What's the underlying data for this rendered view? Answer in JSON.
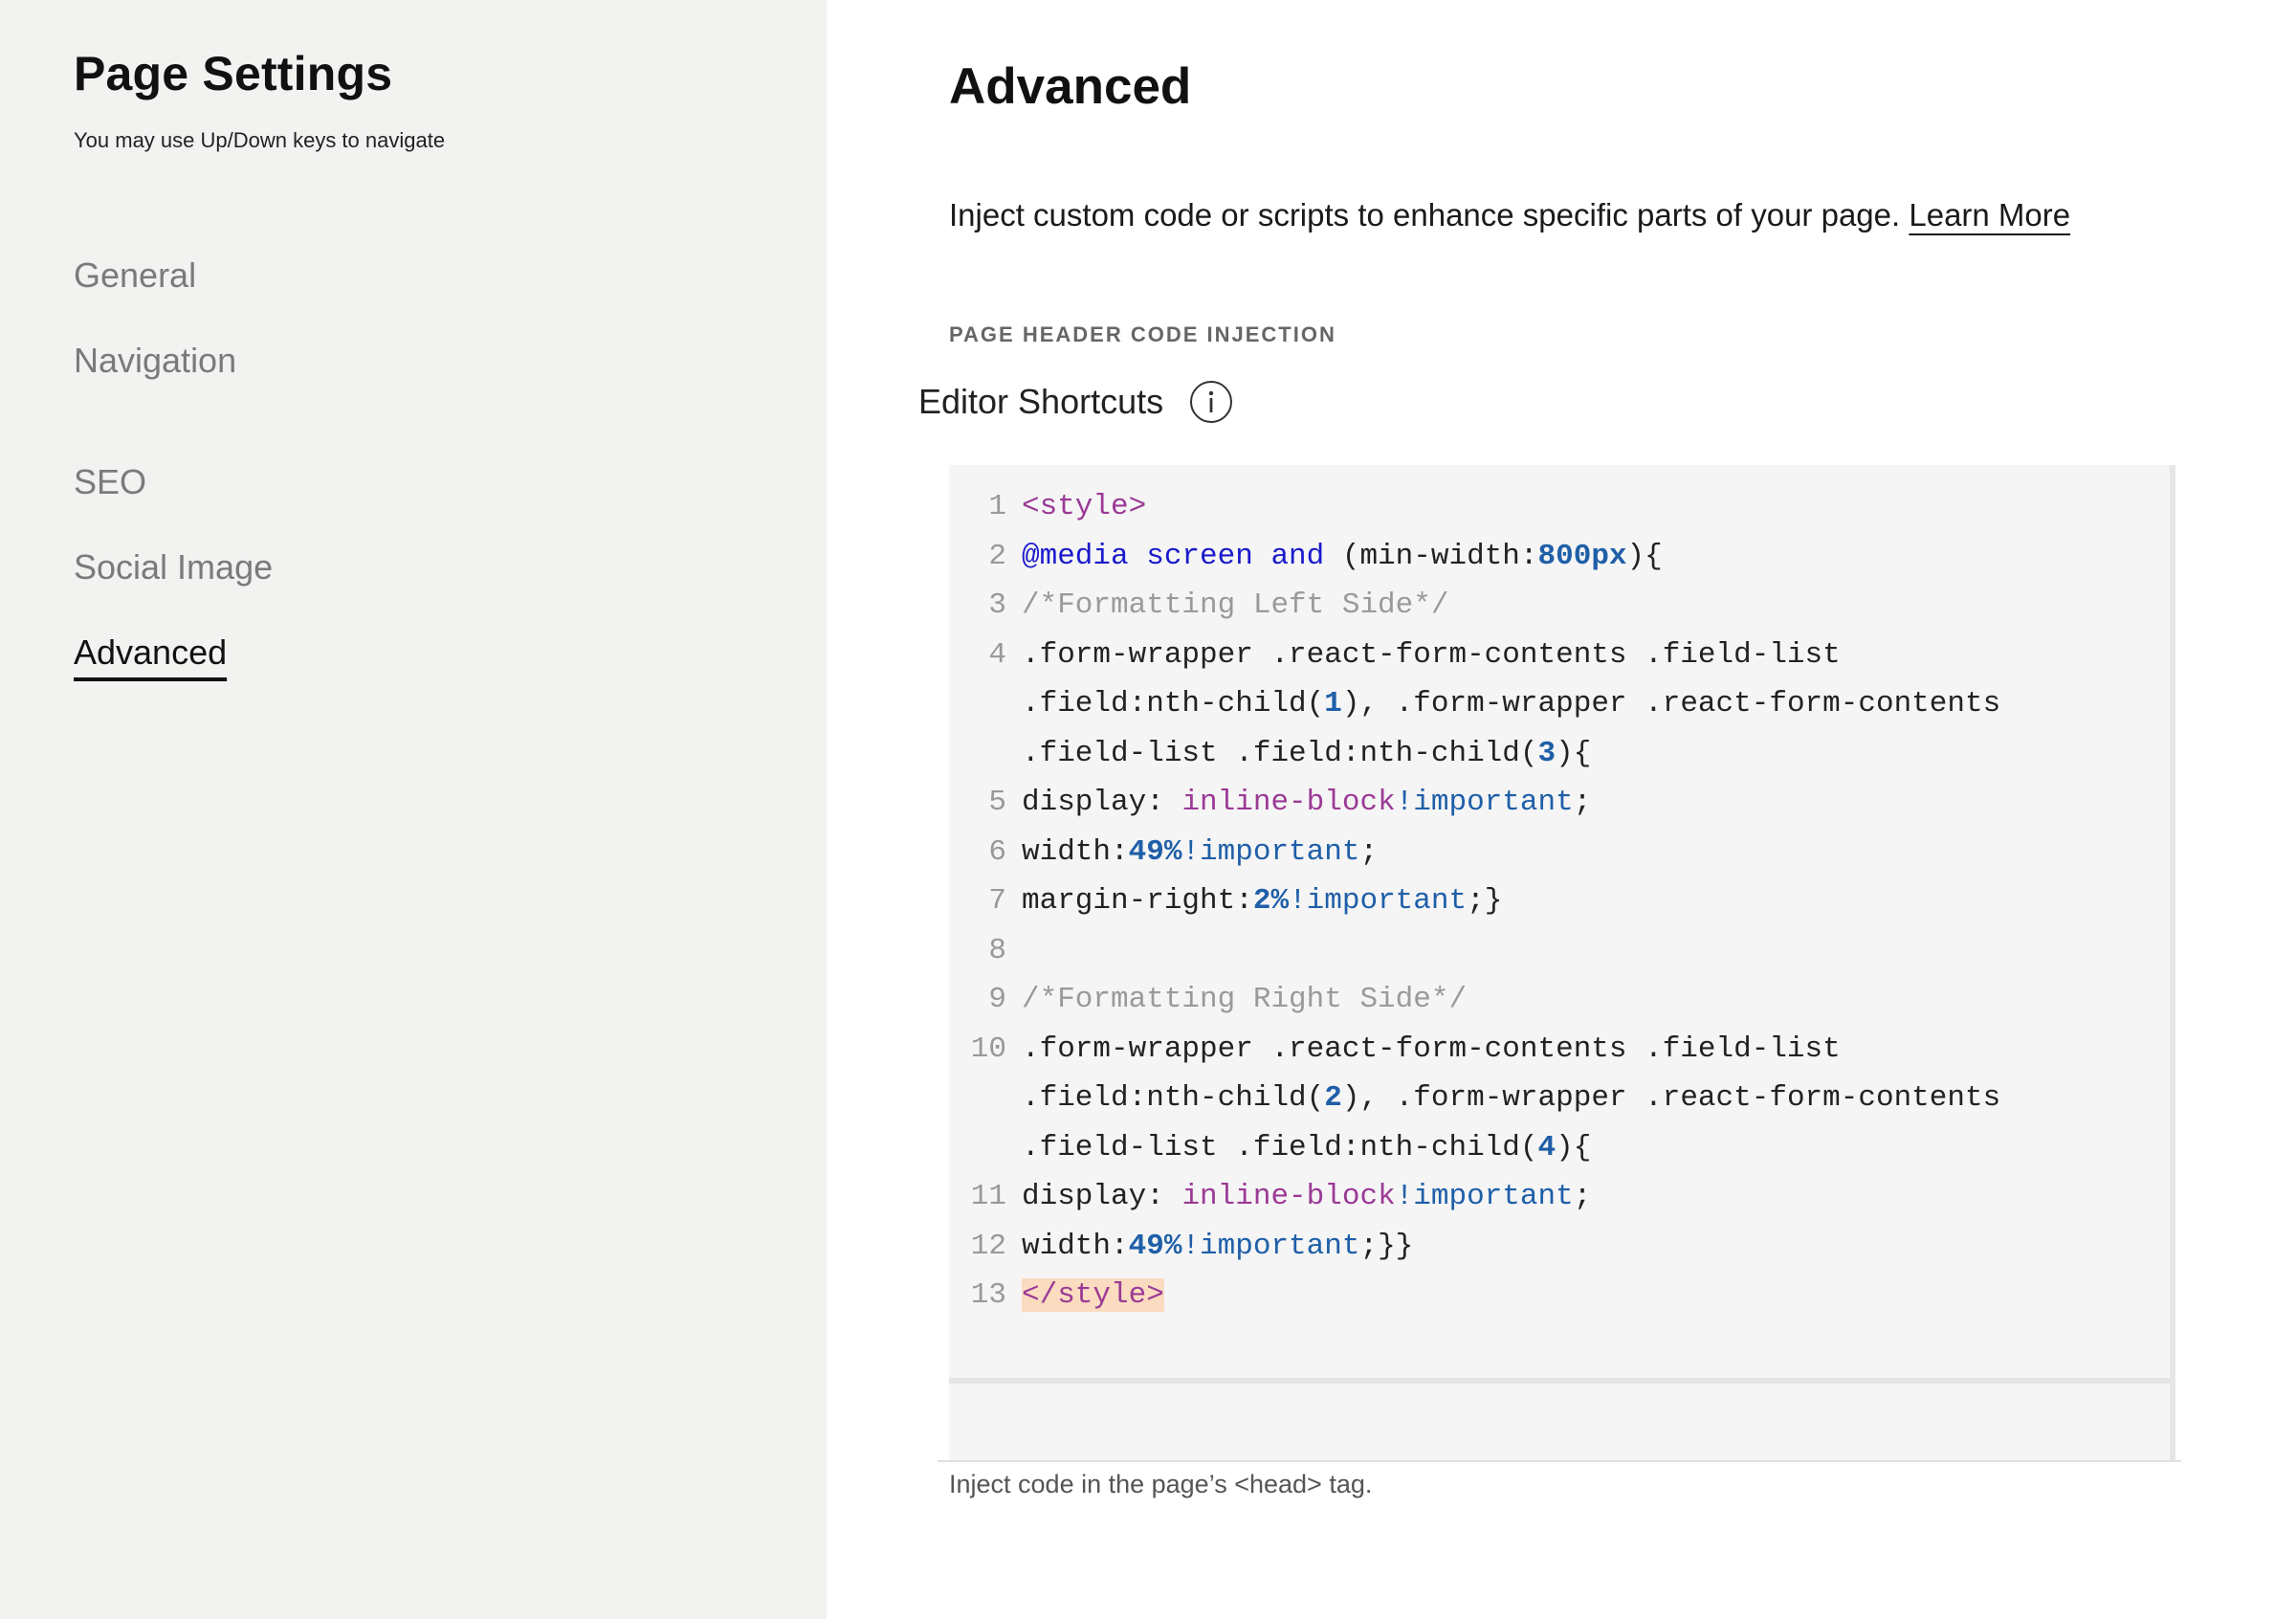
{
  "sidebar": {
    "title": "Page Settings",
    "subtitle": "You may use Up/Down keys to navigate",
    "items": [
      {
        "label": "General",
        "active": false
      },
      {
        "label": "Navigation",
        "active": false
      },
      {
        "label": "SEO",
        "active": false
      },
      {
        "label": "Social Image",
        "active": false
      },
      {
        "label": "Advanced",
        "active": true
      }
    ]
  },
  "main": {
    "title": "Advanced",
    "intro_text": "Inject custom code or scripts to enhance specific parts of your page.",
    "learn_more": "Learn More",
    "section_label": "PAGE HEADER CODE INJECTION",
    "editor_shortcuts": "Editor Shortcuts",
    "editor_shortcuts_icon": "info-icon",
    "hint": "Inject code in the page’s <head> tag."
  },
  "code": {
    "lines": [
      {
        "n": "1",
        "segments": [
          {
            "t": "<style>",
            "c": "tag"
          }
        ]
      },
      {
        "n": "2",
        "segments": [
          {
            "t": "@media screen and",
            "c": "kw"
          },
          {
            "t": " (min-width:",
            "c": ""
          },
          {
            "t": "800px",
            "c": "num"
          },
          {
            "t": "){",
            "c": ""
          }
        ]
      },
      {
        "n": "3",
        "segments": [
          {
            "t": "/*Formatting Left Side*/",
            "c": "cmt"
          }
        ]
      },
      {
        "n": "4",
        "segments": [
          {
            "t": ".form-wrapper .react-form-contents .field-list",
            "c": ""
          }
        ]
      },
      {
        "n": "",
        "segments": [
          {
            "t": ".field:nth-child(",
            "c": ""
          },
          {
            "t": "1",
            "c": "num"
          },
          {
            "t": "), .form-wrapper .react-form-contents",
            "c": ""
          }
        ]
      },
      {
        "n": "",
        "segments": [
          {
            "t": ".field-list .field:nth-child(",
            "c": ""
          },
          {
            "t": "3",
            "c": "num"
          },
          {
            "t": "){",
            "c": ""
          }
        ]
      },
      {
        "n": "5",
        "segments": [
          {
            "t": "display: ",
            "c": ""
          },
          {
            "t": "inline-block",
            "c": "atom"
          },
          {
            "t": "!important",
            "c": "imp"
          },
          {
            "t": ";",
            "c": ""
          }
        ]
      },
      {
        "n": "6",
        "segments": [
          {
            "t": "width:",
            "c": ""
          },
          {
            "t": "49%",
            "c": "num"
          },
          {
            "t": "!important",
            "c": "imp"
          },
          {
            "t": ";",
            "c": ""
          }
        ]
      },
      {
        "n": "7",
        "segments": [
          {
            "t": "margin-right:",
            "c": ""
          },
          {
            "t": "2%",
            "c": "num"
          },
          {
            "t": "!important",
            "c": "imp"
          },
          {
            "t": ";}",
            "c": ""
          }
        ]
      },
      {
        "n": "8",
        "segments": []
      },
      {
        "n": "9",
        "segments": [
          {
            "t": "/*Formatting Right Side*/",
            "c": "cmt"
          }
        ]
      },
      {
        "n": "10",
        "segments": [
          {
            "t": ".form-wrapper .react-form-contents .field-list",
            "c": ""
          }
        ]
      },
      {
        "n": "",
        "segments": [
          {
            "t": ".field:nth-child(",
            "c": ""
          },
          {
            "t": "2",
            "c": "num"
          },
          {
            "t": "), .form-wrapper .react-form-contents",
            "c": ""
          }
        ]
      },
      {
        "n": "",
        "segments": [
          {
            "t": ".field-list .field:nth-child(",
            "c": ""
          },
          {
            "t": "4",
            "c": "num"
          },
          {
            "t": "){",
            "c": ""
          }
        ]
      },
      {
        "n": "11",
        "segments": [
          {
            "t": "display: ",
            "c": ""
          },
          {
            "t": "inline-block",
            "c": "atom"
          },
          {
            "t": "!important",
            "c": "imp"
          },
          {
            "t": ";",
            "c": ""
          }
        ]
      },
      {
        "n": "12",
        "segments": [
          {
            "t": "width:",
            "c": ""
          },
          {
            "t": "49%",
            "c": "num"
          },
          {
            "t": "!important",
            "c": "imp"
          },
          {
            "t": ";}}",
            "c": ""
          }
        ]
      },
      {
        "n": "13",
        "segments": [
          {
            "t": "</style>",
            "c": "tag hl"
          }
        ]
      }
    ]
  }
}
